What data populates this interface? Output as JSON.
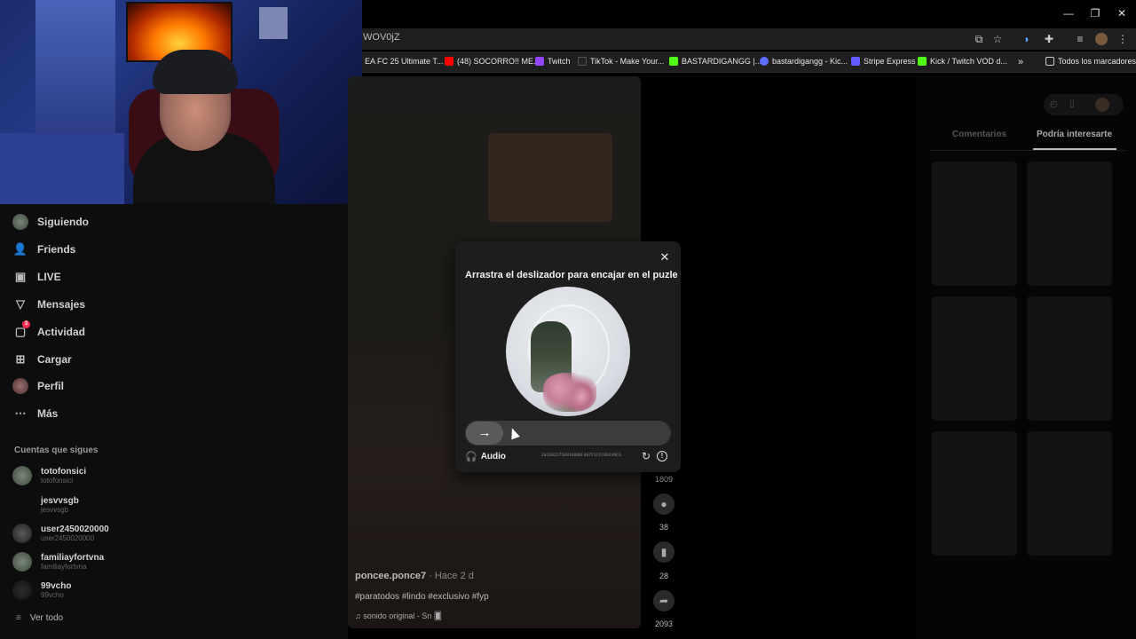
{
  "window": {
    "minimize": "—",
    "restore": "❐",
    "close": "✕"
  },
  "browser": {
    "url": "WOV0jZ",
    "bookmarks": [
      {
        "label": "EA FC 25 Ultimate T...",
        "color": "#1a1a1a"
      },
      {
        "label": "(48) SOCORRO!! ME...",
        "color": "#ff0000"
      },
      {
        "label": "Twitch",
        "color": "#9146ff"
      },
      {
        "label": "TikTok - Make Your...",
        "color": "#000000"
      },
      {
        "label": "BASTARDIGANGG |...",
        "color": "#53fc18"
      },
      {
        "label": "bastardigangg - Kic...",
        "color": "#5b6cff"
      },
      {
        "label": "Stripe Express",
        "color": "#635bff"
      },
      {
        "label": "Kick / Twitch VOD d...",
        "color": "#53fc18"
      }
    ],
    "bookmarks_more": "»",
    "all_bookmarks": "Todos los marcadores"
  },
  "sidebar": {
    "nav": [
      {
        "label": "Siguiendo",
        "icon": "following-avatar-icon"
      },
      {
        "label": "Friends",
        "icon": "friends-icon"
      },
      {
        "label": "LIVE",
        "icon": "live-icon"
      },
      {
        "label": "Mensajes",
        "icon": "messages-icon"
      },
      {
        "label": "Actividad",
        "icon": "activity-icon"
      },
      {
        "label": "Cargar",
        "icon": "upload-icon"
      },
      {
        "label": "Perfil",
        "icon": "profile-avatar-icon"
      },
      {
        "label": "Más",
        "icon": "more-icon"
      }
    ],
    "activity_badge": "3",
    "following_heading": "Cuentas que sigues",
    "accounts": [
      {
        "name": "totofonsici",
        "handle": "totofonsici"
      },
      {
        "name": "jesvvsgb",
        "handle": "jesvvsgb"
      },
      {
        "name": "user2450020000",
        "handle": "user2450020000"
      },
      {
        "name": "familiayfortvna",
        "handle": "familiayfortvna"
      },
      {
        "name": "99vcho",
        "handle": "99vcho"
      }
    ],
    "see_all": "Ver todo"
  },
  "video": {
    "username": "poncee.ponce7",
    "time": " · Hace 2 d",
    "tags": "#paratodos #lindo #exclusivo #fyp",
    "sound": "♫  sonido original - Sn 🂠",
    "likes": "1809",
    "comments": "38",
    "saves": "28",
    "shares": "2093"
  },
  "right_panel": {
    "tabs": [
      "Comentarios",
      "Podría interesarte"
    ],
    "active_tab": 1
  },
  "captcha": {
    "title": "Arrastra el deslizador para encajar en el puzle",
    "close": "✕",
    "slider_arrow": "→",
    "audio_label": "Audio",
    "id_text": "202602275093408BF407F3CFC00249C6",
    "refresh": "↻",
    "info": "!"
  }
}
